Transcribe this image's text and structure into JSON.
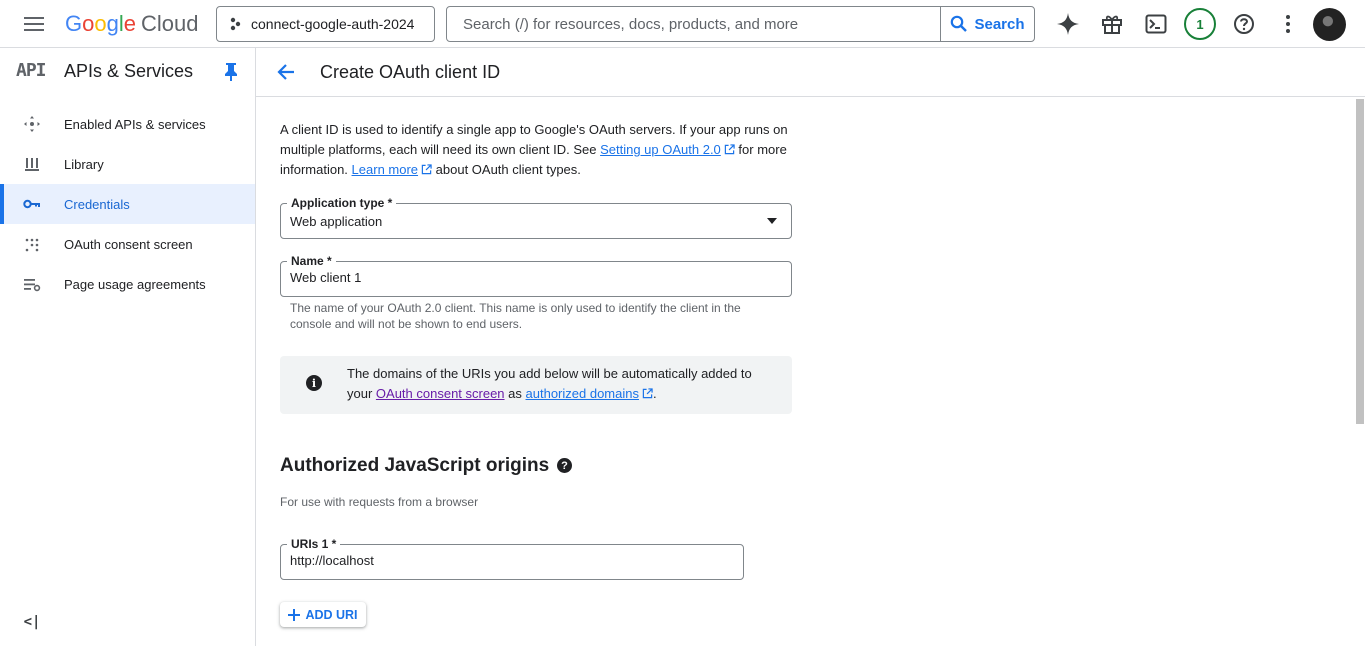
{
  "topbar": {
    "logo_google": "Google",
    "logo_cloud": "Cloud",
    "project": "connect-google-auth-2024",
    "search_placeholder": "Search (/) for resources, docs, products, and more",
    "search_button": "Search",
    "notification_count": "1"
  },
  "sidebar": {
    "badge": "API",
    "title": "APIs & Services",
    "items": [
      {
        "label": "Enabled APIs & services",
        "icon": "enabled-apis-icon"
      },
      {
        "label": "Library",
        "icon": "library-icon"
      },
      {
        "label": "Credentials",
        "icon": "key-icon",
        "active": true
      },
      {
        "label": "OAuth consent screen",
        "icon": "consent-icon"
      },
      {
        "label": "Page usage agreements",
        "icon": "agreements-icon"
      }
    ],
    "collapse": "<|"
  },
  "main": {
    "title": "Create OAuth client ID",
    "intro_1": "A client ID is used to identify a single app to Google's OAuth servers. If your app runs on multiple platforms, each will need its own client ID. See ",
    "intro_link_1": "Setting up OAuth 2.0",
    "intro_2": " for more information. ",
    "intro_link_2": "Learn more",
    "intro_3": " about OAuth client types.",
    "app_type_label": "Application type *",
    "app_type_value": "Web application",
    "name_label": "Name *",
    "name_value": "Web client 1",
    "name_hint": "The name of your OAuth 2.0 client. This name is only used to identify the client in the console and will not be shown to end users.",
    "info_1": "The domains of the URIs you add below will be automatically added to your ",
    "info_link_1": "OAuth consent screen",
    "info_2": " as ",
    "info_link_2": "authorized domains",
    "info_3": ".",
    "js_origins_title": "Authorized JavaScript origins",
    "js_origins_sub": "For use with requests from a browser",
    "uri_label": "URIs 1 *",
    "uri_value": "http://localhost",
    "add_uri": "ADD URI"
  },
  "colors": {
    "accent": "#1a73e8",
    "active_bg": "#e8f0fe",
    "badge_green": "#188038",
    "visited_link": "#681da8"
  }
}
